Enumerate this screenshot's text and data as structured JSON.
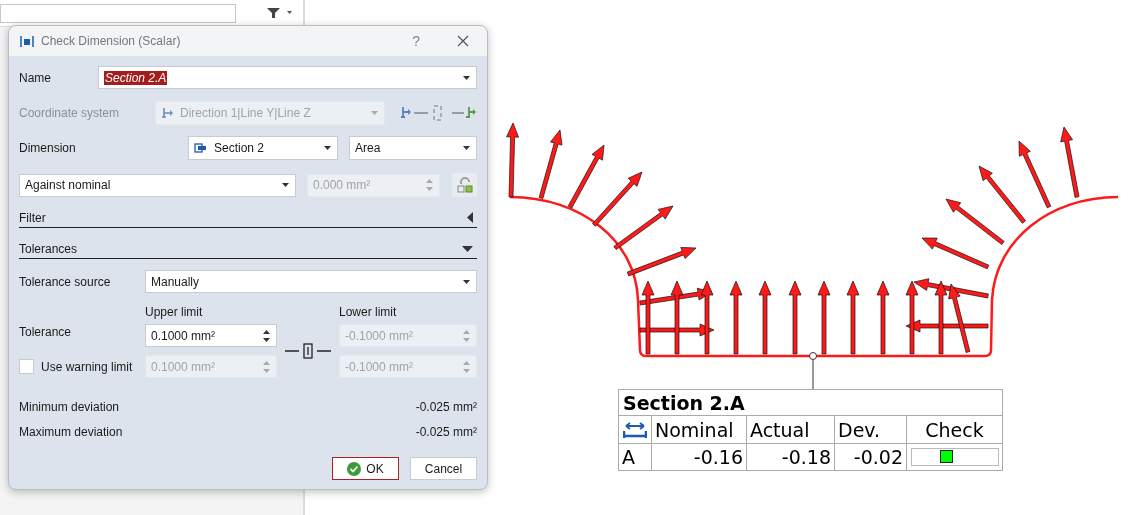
{
  "dialog": {
    "title": "Check Dimension (Scalar)",
    "help": "?",
    "name": {
      "label": "Name",
      "value": "Section 2.A"
    },
    "coordinate_system": {
      "label": "Coordinate system",
      "value": "Direction 1|Line Y|Line Z",
      "disabled": true
    },
    "dimension": {
      "label": "Dimension",
      "section": "Section 2",
      "measure": "Area"
    },
    "comparison": {
      "mode": "Against nominal",
      "value": "0.000 mm²",
      "disabled": true
    },
    "sections": [
      {
        "title": "Filter",
        "expanded": false
      },
      {
        "title": "Tolerances",
        "expanded": true
      }
    ],
    "tolerance_source": {
      "label": "Tolerance source",
      "value": "Manually"
    },
    "tolerance": {
      "label": "Tolerance",
      "upper_label": "Upper limit",
      "lower_label": "Lower limit",
      "upper": {
        "value": "0.1000 mm²",
        "disabled": false
      },
      "lower": {
        "value": "-0.1000 mm²",
        "disabled": true
      }
    },
    "warning": {
      "label": "Use warning limit",
      "checked": false,
      "upper": {
        "value": "0.1000 mm²",
        "disabled": true
      },
      "lower": {
        "value": "-0.1000 mm²",
        "disabled": true
      }
    },
    "deviations": [
      {
        "label": "Minimum deviation",
        "value": "-0.025 mm²"
      },
      {
        "label": "Maximum deviation",
        "value": "-0.025 mm²"
      }
    ],
    "buttons": [
      {
        "label": "OK",
        "default": true
      },
      {
        "label": "Cancel",
        "default": false
      }
    ]
  },
  "label_table": {
    "title": "Section 2.A",
    "columns": [
      "Nominal",
      "Actual",
      "Dev.",
      "Check"
    ],
    "rows": [
      {
        "name": "A",
        "values": [
          "-0.16",
          "-0.18",
          "-0.02"
        ],
        "color": "#00ff00"
      }
    ]
  }
}
